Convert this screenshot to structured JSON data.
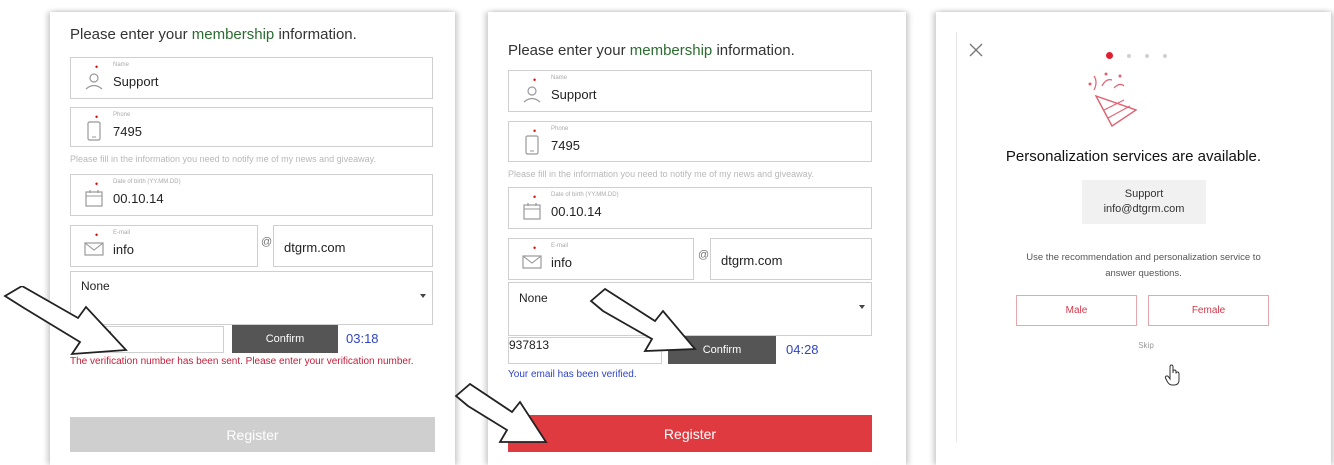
{
  "panel1": {
    "heading": "Please enter your membership information.",
    "name_label": "Name",
    "name_value": "Support",
    "phone_label": "Phone",
    "phone_value": "7495",
    "notify_hint": "Please fill in the information you need to notify me of my news and giveaway.",
    "dob_label": "Date of birth (YY.MM.DD)",
    "dob_value": "00.10.14",
    "email_label": "E-mail",
    "email_user": "info",
    "at_sign": "@",
    "email_domain": "dtgrm.com",
    "select_value": "None",
    "code_value": "",
    "confirm_label": "Confirm",
    "timer": "03:18",
    "message": "The verification number has been sent. Please enter your verification number.",
    "register_label": "Register"
  },
  "panel2": {
    "heading": "Please enter your membership information.",
    "name_label": "Name",
    "name_value": "Support",
    "phone_label": "Phone",
    "phone_value": "7495",
    "notify_hint": "Please fill in the information you need to notify me of my news and giveaway.",
    "dob_label": "Date of birth (YY.MM.DD)",
    "dob_value": "00.10.14",
    "email_label": "E-mail",
    "email_user": "info",
    "at_sign": "@",
    "email_domain": "dtgrm.com",
    "select_value": "None",
    "code_value": "937813",
    "confirm_label": "Confirm",
    "timer": "04:28",
    "message": "Your email has been verified.",
    "register_label": "Register"
  },
  "panel3": {
    "title": "Personalization services are available.",
    "user_name": "Support",
    "user_email": "info@dtgrm.com",
    "description": "Use the recommendation and personalization service to answer questions.",
    "male_label": "Male",
    "female_label": "Female",
    "skip_label": "Skip",
    "icons": [
      "close-icon",
      "party-popper-icon",
      "hand-pointer-icon"
    ]
  },
  "colors": {
    "accent_red": "#e03a41",
    "confirm_gray": "#555555",
    "timer_blue": "#2f44c6",
    "error_red": "#c0203a",
    "disabled_gray": "#cfcfcf",
    "heading_highlight": "#2a6d2f"
  }
}
